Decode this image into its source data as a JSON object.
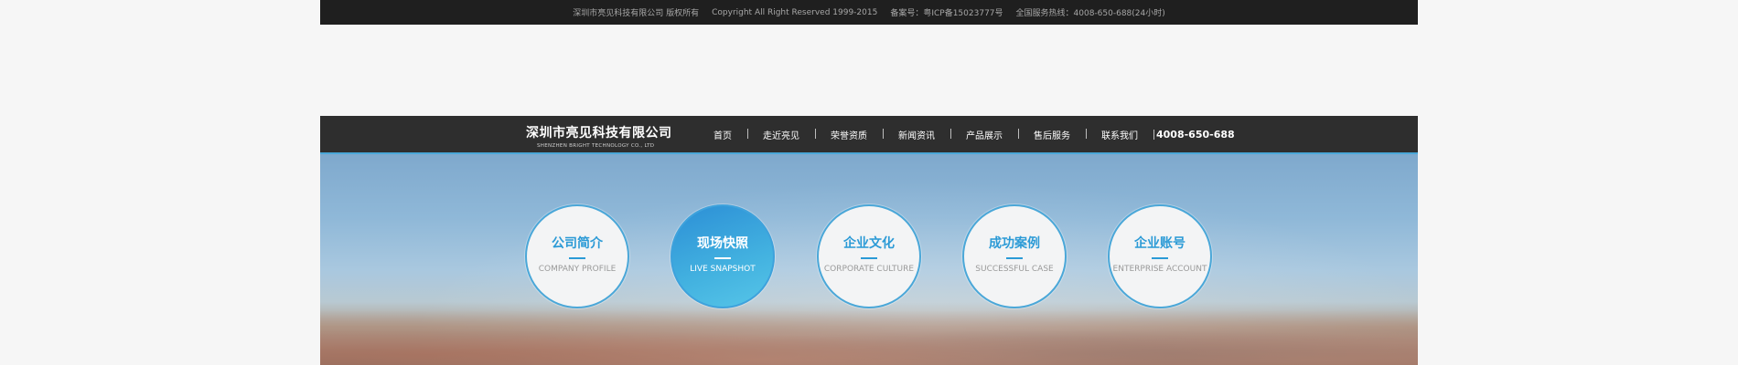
{
  "footer": {
    "copyright_cn": "深圳市亮见科技有限公司 版权所有",
    "copyright_en": "Copyright All Right Reserved 1999-2015",
    "icp": "备案号：粤ICP备15023777号",
    "hotline": "全国服务热线：4008-650-688(24小时)"
  },
  "brand": {
    "name_cn": "深圳市亮见科技有限公司",
    "name_en": "SHENZHEN BRIGHT TECHNOLOGY CO., LTD"
  },
  "nav": {
    "items": [
      {
        "label": "首页"
      },
      {
        "label": "走近亮见"
      },
      {
        "label": "荣誉资质"
      },
      {
        "label": "新闻资讯"
      },
      {
        "label": "产品展示"
      },
      {
        "label": "售后服务"
      },
      {
        "label": "联系我们"
      }
    ],
    "phone": "4008-650-688"
  },
  "sections": [
    {
      "title": "公司简介",
      "subtitle": "COMPANY PROFILE",
      "active": false
    },
    {
      "title": "现场快照",
      "subtitle": "LIVE SNAPSHOT",
      "active": true
    },
    {
      "title": "企业文化",
      "subtitle": "CORPORATE CULTURE",
      "active": false
    },
    {
      "title": "成功案例",
      "subtitle": "SUCCESSFUL CASE",
      "active": false
    },
    {
      "title": "企业账号",
      "subtitle": "ENTERPRISE ACCOUNT",
      "active": false
    }
  ],
  "colors": {
    "accent": "#2b9ad6",
    "nav_bg": "#2e2e2e",
    "footer_bg": "#1f1f1f"
  }
}
